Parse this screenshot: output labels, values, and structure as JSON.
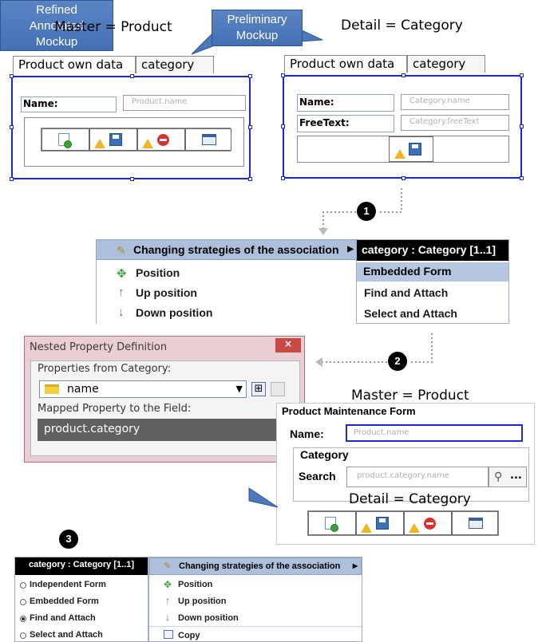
{
  "top": {
    "left_title": "Master = Product",
    "right_title": "Detail = Category",
    "callout_line1": "Preliminary",
    "callout_line2": "Mockup"
  },
  "left_panel": {
    "tabs": [
      "Product own data",
      "category"
    ],
    "name_label": "Name:",
    "name_placeholder": "Product.name"
  },
  "right_panel": {
    "tabs": [
      "Product own data",
      "category"
    ],
    "name_label": "Name:",
    "name_placeholder": "Category.name",
    "freetext_label": "FreeText:",
    "freetext_placeholder": "Category.freeText"
  },
  "steps": [
    "1",
    "2",
    "3"
  ],
  "menu1": {
    "header": "Changing strategies of the association",
    "submenu_header": "category : Category [1..1]",
    "items": [
      "Position",
      "Up position",
      "Down position"
    ],
    "sub_items": [
      "Embedded Form",
      "Find and Attach",
      "Select and Attach"
    ]
  },
  "dialog": {
    "title": "Nested Property Definition",
    "close": "×",
    "props_label": "Properties from Category:",
    "selected_prop": "name",
    "mapped_label": "Mapped Property to the Field:",
    "mapped_value": "product.category"
  },
  "refined": {
    "master_title": "Master = Product",
    "form_title": "Product Maintenance Form",
    "name_label": "Name:",
    "name_placeholder": "Product.name",
    "category_group": "Category",
    "search_label": "Search",
    "search_placeholder": "product.category.name",
    "browse_label": "...",
    "detail_title": "Detail = Category",
    "callout_line1": "Refined",
    "callout_line2": "Annotated",
    "callout_line3": "Mockup"
  },
  "menu3": {
    "left_header": "category : Category [1..1]",
    "left_items": [
      "Independent Form",
      "Embedded Form",
      "Find and Attach",
      "Select and Attach"
    ],
    "selected_index": 2,
    "right_header": "Changing strategies of the association",
    "right_items": [
      "Position",
      "Up position",
      "Down position",
      "Copy"
    ]
  }
}
